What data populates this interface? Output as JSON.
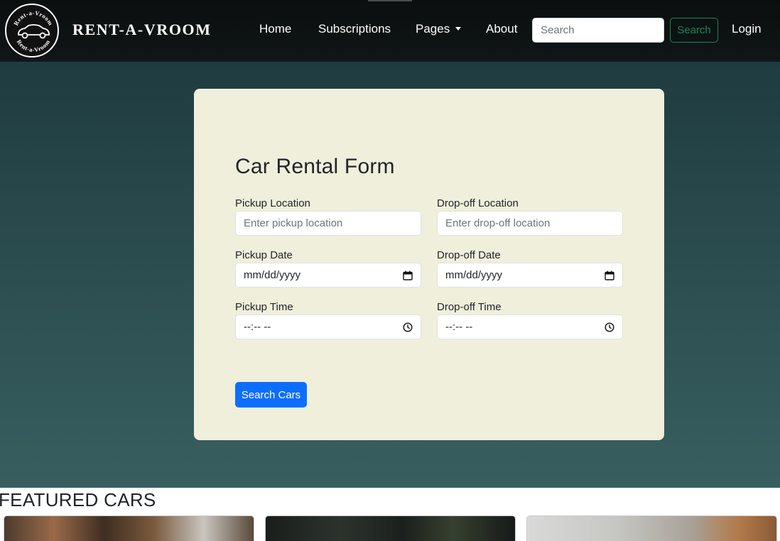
{
  "nav": {
    "brand": "RENT-A-VROOM",
    "logo_text_top": "Rent-a-Vroom",
    "logo_text_bottom": "Rent-a-Vroom",
    "links": {
      "home": "Home",
      "subscriptions": "Subscriptions",
      "pages": "Pages",
      "about": "About",
      "login": "Login"
    },
    "search_placeholder": "Search",
    "search_button": "Search"
  },
  "form": {
    "title": "Car Rental Form",
    "pickup_location": {
      "label": "Pickup Location",
      "placeholder": "Enter pickup location"
    },
    "dropoff_location": {
      "label": "Drop-off Location",
      "placeholder": "Enter drop-off location"
    },
    "pickup_date": {
      "label": "Pickup Date",
      "value": "mm/dd/yyyy"
    },
    "dropoff_date": {
      "label": "Drop-off Date",
      "value": "mm/dd/yyyy"
    },
    "pickup_time": {
      "label": "Pickup Time",
      "value": "--:-- --"
    },
    "dropoff_time": {
      "label": "Drop-off Time",
      "value": "--:-- --"
    },
    "submit": "Search Cars"
  },
  "featured": {
    "title": "FEATURED CARS"
  },
  "colors": {
    "primary": "#0d6efd",
    "success": "#198754",
    "card_bg": "#f0efdb",
    "hero_top": "#1f3c40",
    "hero_bottom": "#385f5f"
  },
  "icons": [
    "car-icon",
    "caret-down-icon",
    "calendar-icon",
    "clock-icon"
  ]
}
